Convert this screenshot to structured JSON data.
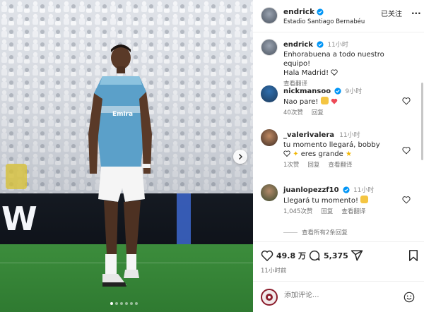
{
  "post": {
    "author": "endrick",
    "location": "Estadio Santiago Bernabéu",
    "follow_label": "已关注",
    "more_label": "...",
    "caption_time": "11小时",
    "caption_line1": "Enhorabuena a todo nuestro equipo!",
    "caption_line2": "Hala Madrid!",
    "see_translation": "查看翻译",
    "likes": "49.8 万",
    "comments_count": "5,375",
    "time_ago": "11小时前",
    "photo_board_text": "W",
    "carousel_pages": 6,
    "carousel_active": 1
  },
  "comments": [
    {
      "user": "nickmansoo",
      "verified": true,
      "time": "9小时",
      "text": "Nao pare!",
      "likes": "40次赞",
      "reply": "回复"
    },
    {
      "user": "_valerivalera",
      "verified": false,
      "time": "11小时",
      "text": "tu momento llegará, bobby",
      "text2": "eres grande",
      "likes": "1次赞",
      "reply": "回复",
      "translate": "查看翻译"
    },
    {
      "user": "juanlopezzf10",
      "verified": true,
      "time": "11小时",
      "text": "Llegará tu momento!",
      "likes": "1,045次赞",
      "reply": "回复",
      "translate": "查看翻译"
    }
  ],
  "view_replies_label": "查看所有2条回复",
  "composer": {
    "placeholder": "添加评论..."
  },
  "colors": {
    "verified": "#0095f6",
    "like_red": "#ed4956",
    "muted": "#737373"
  },
  "icons": [
    "heart-icon",
    "comment-icon",
    "share-icon",
    "bookmark-icon",
    "verified-icon",
    "emoji-icon",
    "chevron-right-icon",
    "more-icon"
  ]
}
